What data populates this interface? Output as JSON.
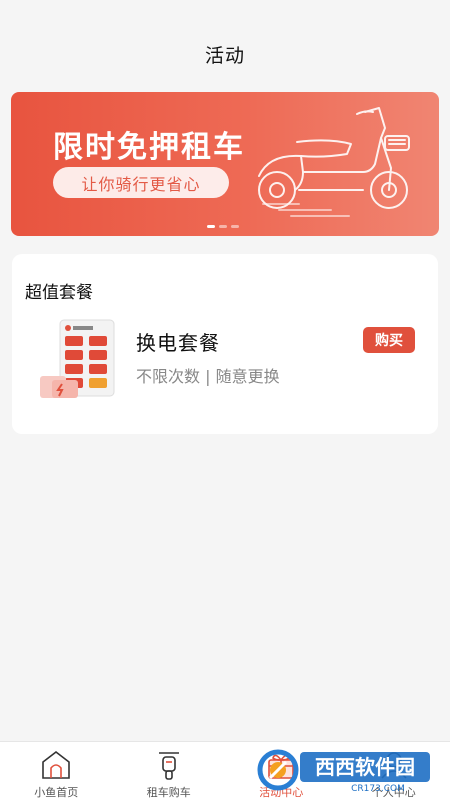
{
  "header": {
    "title": "活动"
  },
  "banner": {
    "headline": "限时免押租车",
    "subtitle": "让你骑行更省心",
    "page_count": 3,
    "active_index": 0
  },
  "packages_card": {
    "section_title": "超值套餐",
    "items": [
      {
        "name": "换电套餐",
        "description": "不限次数 | 随意更换",
        "buy_label": "购买"
      }
    ]
  },
  "tabbar": {
    "items": [
      {
        "label": "小鱼首页",
        "icon": "home-icon"
      },
      {
        "label": "租车购车",
        "icon": "scooter-icon"
      },
      {
        "label": "活动中心",
        "icon": "gift-icon",
        "active": true
      },
      {
        "label": "个人中心",
        "icon": "person-icon"
      }
    ]
  },
  "watermark": {
    "text": "西西软件园",
    "url_text": "CR173.COM"
  },
  "colors": {
    "accent": "#e0503c",
    "banner_start": "#e8543f",
    "banner_end": "#f08572"
  }
}
